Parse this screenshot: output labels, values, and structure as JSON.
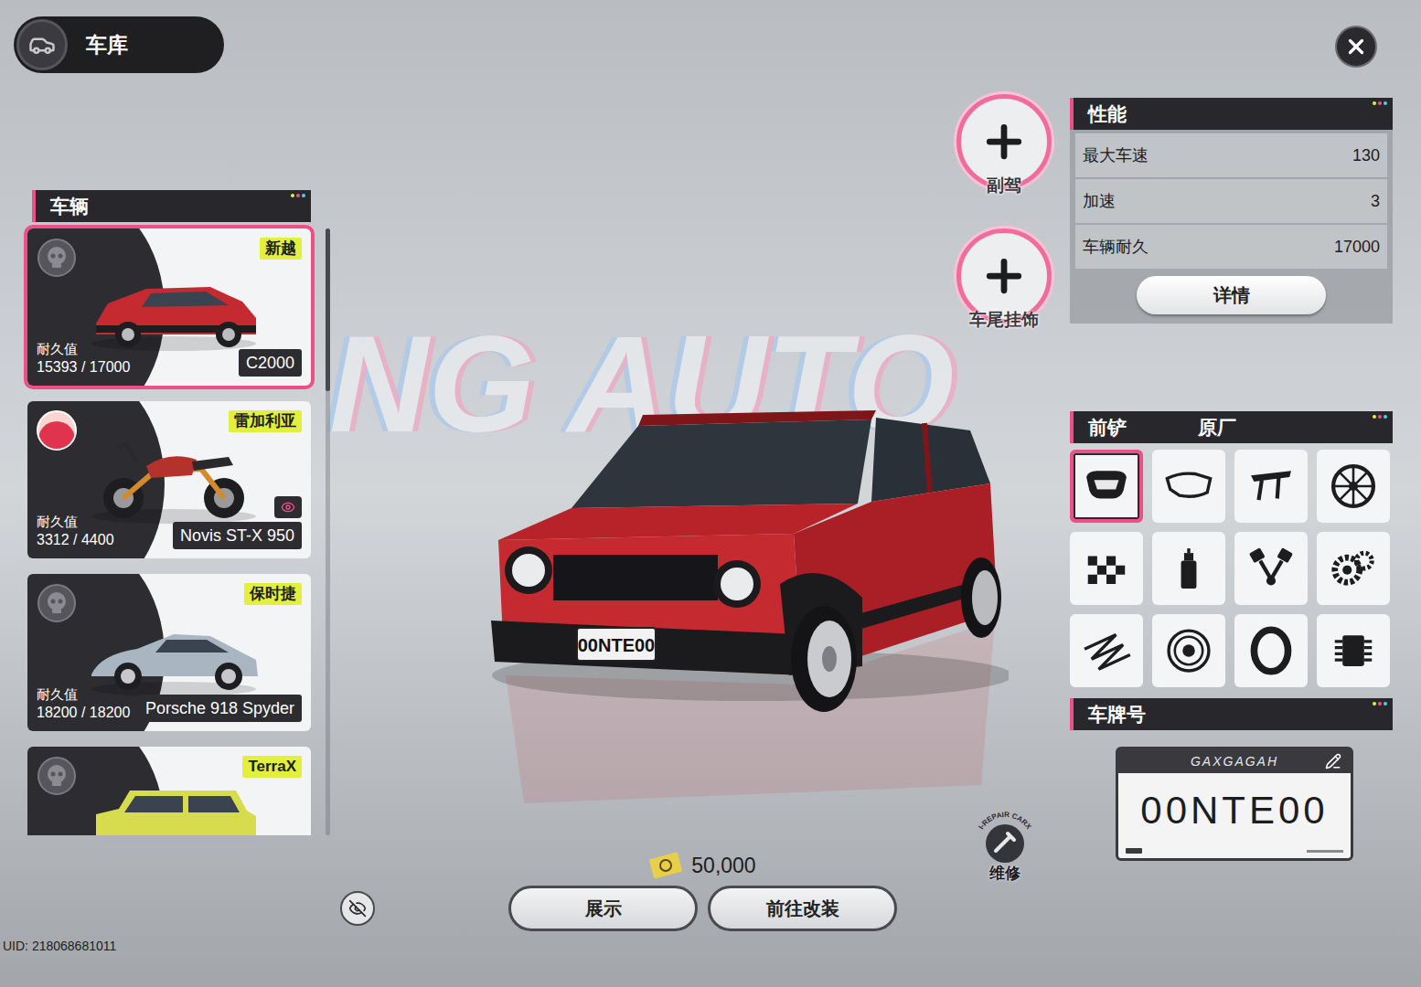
{
  "header": {
    "title": "车库"
  },
  "backdrop": {
    "text": "NG AUTO"
  },
  "vehicle_panel": {
    "title": "车辆"
  },
  "vehicles": [
    {
      "kind": "sedan",
      "brand": "新越",
      "name": "C2000",
      "durability_label": "耐久值",
      "durability": "15393 / 17000",
      "selected": true,
      "has_avatar": false,
      "eye_badge": false,
      "color": "#c42a30"
    },
    {
      "kind": "motorcycle",
      "brand": "雷加利亚",
      "name": "Novis ST-X 950",
      "durability_label": "耐久值",
      "durability": "3312 / 4400",
      "selected": false,
      "has_avatar": true,
      "eye_badge": true,
      "color": "#b3322c"
    },
    {
      "kind": "sports",
      "brand": "保时捷",
      "name": "Porsche 918 Spyder",
      "durability_label": "耐久值",
      "durability": "18200 / 18200",
      "selected": false,
      "has_avatar": false,
      "eye_badge": false,
      "color": "#a9b6c2"
    },
    {
      "kind": "suv",
      "brand": "TerraX",
      "selected": false,
      "has_avatar": false,
      "eye_badge": false,
      "color": "#d7dc4e"
    }
  ],
  "slots": [
    {
      "label": "副驾"
    },
    {
      "label": "车尾挂饰"
    }
  ],
  "performance": {
    "title": "性能",
    "stats": [
      {
        "label": "最大车速",
        "value": "130"
      },
      {
        "label": "加速",
        "value": "3"
      },
      {
        "label": "车辆耐久",
        "value": "17000"
      }
    ],
    "details_button": "详情"
  },
  "parts": {
    "category": "前铲",
    "option": "原厂",
    "slots": [
      {
        "selected": true
      },
      {
        "selected": false
      },
      {
        "selected": false
      },
      {
        "selected": false
      },
      {
        "selected": false
      },
      {
        "selected": false
      },
      {
        "selected": false
      },
      {
        "selected": false
      },
      {
        "selected": false
      },
      {
        "selected": false
      },
      {
        "selected": false
      },
      {
        "selected": false
      }
    ]
  },
  "plate": {
    "title": "车牌号",
    "brand": "GAXGAGAH",
    "number": "00NTE00"
  },
  "currency": {
    "amount": "50,000"
  },
  "repair": {
    "ring_text": "I-REPAIR CARX",
    "label": "维修"
  },
  "actions": [
    {
      "label": "展示"
    },
    {
      "label": "前往改装"
    }
  ],
  "uid": "UID: 218068681011"
}
